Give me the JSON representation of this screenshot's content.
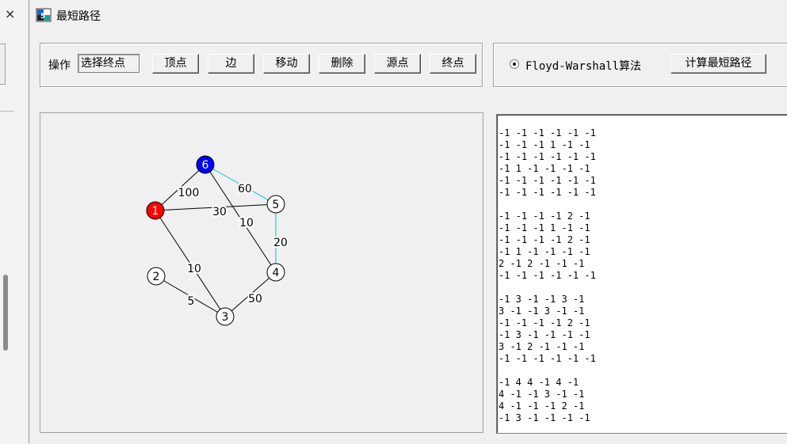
{
  "left_window": {
    "close_glyph": "×"
  },
  "window": {
    "title": "最短路径",
    "icon": "app-icon"
  },
  "toolbar": {
    "operation_label": "操作",
    "mode_value": "选择终点",
    "buttons": {
      "vertex": "顶点",
      "edge": "边",
      "move": "移动",
      "delete": "删除",
      "source": "源点",
      "target": "终点"
    }
  },
  "algorithm": {
    "radio_label": "Floyd-Warshall算法",
    "radio_selected": true,
    "compute_button": "计算最短路径"
  },
  "graph": {
    "nodes": [
      {
        "id": "1",
        "label": "1",
        "role": "source",
        "color": "#ff0000"
      },
      {
        "id": "2",
        "label": "2",
        "role": "normal",
        "color": "#ffffff"
      },
      {
        "id": "3",
        "label": "3",
        "role": "normal",
        "color": "#ffffff"
      },
      {
        "id": "4",
        "label": "4",
        "role": "normal",
        "color": "#ffffff"
      },
      {
        "id": "5",
        "label": "5",
        "role": "normal",
        "color": "#ffffff"
      },
      {
        "id": "6",
        "label": "6",
        "role": "target",
        "color": "#0000ff"
      }
    ],
    "edges": [
      {
        "from": "1",
        "to": "6",
        "weight": "100",
        "highlight": false
      },
      {
        "from": "1",
        "to": "5",
        "weight": "30",
        "highlight": false
      },
      {
        "from": "1",
        "to": "3",
        "weight": "10",
        "highlight": false
      },
      {
        "from": "6",
        "to": "5",
        "weight": "60",
        "highlight": true
      },
      {
        "from": "6",
        "to": "4",
        "weight": "10",
        "highlight": false
      },
      {
        "from": "5",
        "to": "4",
        "weight": "20",
        "highlight": true
      },
      {
        "from": "2",
        "to": "3",
        "weight": "5",
        "highlight": false
      },
      {
        "from": "3",
        "to": "4",
        "weight": "50",
        "highlight": false
      }
    ],
    "colors": {
      "edge": "#000000",
      "highlight": "#00c8d8"
    }
  },
  "output": {
    "lines": [
      "-1 -1 -1 -1 -1 -1",
      "-1 -1 -1 1 -1 -1",
      "-1 -1 -1 -1 -1 -1",
      "-1 1 -1 -1 -1 -1",
      "-1 -1 -1 -1 -1 -1",
      "-1 -1 -1 -1 -1 -1",
      "",
      "-1 -1 -1 -1 2 -1",
      "-1 -1 -1 1 -1 -1",
      "-1 -1 -1 -1 2 -1",
      "-1 1 -1 -1 -1 -1",
      "2 -1 2 -1 -1 -1",
      "-1 -1 -1 -1 -1 -1",
      "",
      "-1 3 -1 -1 3 -1",
      "3 -1 -1 3 -1 -1",
      "-1 -1 -1 -1 2 -1",
      "-1 3 -1 -1 -1 -1",
      "3 -1 2 -1 -1 -1",
      "-1 -1 -1 -1 -1 -1",
      "",
      "-1 4 4 -1 4 -1",
      "4 -1 -1 3 -1 -1",
      "4 -1 -1 -1 2 -1",
      "-1 3 -1 -1 -1 -1"
    ]
  }
}
